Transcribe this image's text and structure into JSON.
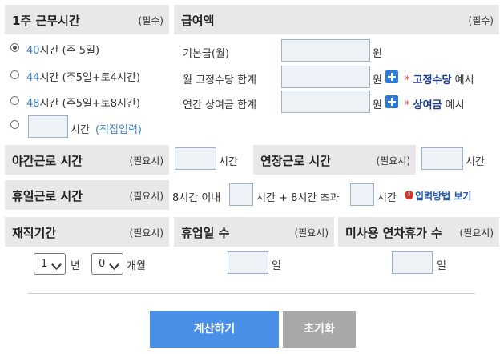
{
  "work_hours": {
    "title": "1주 근무시간",
    "required": "(필수)",
    "options": [
      {
        "hours": "40",
        "unit": "시간",
        "note": "(주 5일)",
        "selected": true
      },
      {
        "hours": "44",
        "unit": "시간",
        "note": "(주5일+토4시간)",
        "selected": false
      },
      {
        "hours": "48",
        "unit": "시간",
        "note": "(주5일+토8시간)",
        "selected": false
      }
    ],
    "custom": {
      "unit": "시간",
      "note": "(직접입력)",
      "value": ""
    }
  },
  "salary": {
    "title": "급여액",
    "required": "(필수)",
    "base": {
      "label": "기본급(월)",
      "unit": "원",
      "value": ""
    },
    "fixed_allowance": {
      "label": "월 고정수당 합계",
      "unit": "원",
      "star": "*",
      "link": "고정수당",
      "suffix": "예시",
      "value": ""
    },
    "bonus": {
      "label": "연간 상여금 합계",
      "unit": "원",
      "star": "*",
      "link": "상여금",
      "suffix": "예시",
      "value": ""
    }
  },
  "night": {
    "title": "야간근로 시간",
    "required": "(필요시)",
    "unit": "시간",
    "value": ""
  },
  "overtime": {
    "title": "연장근로 시간",
    "required": "(필요시)",
    "unit": "시간",
    "value": ""
  },
  "holiday": {
    "title": "휴일근로 시간",
    "required": "(필요시)",
    "within_label": "8시간 이내",
    "mid_label": "시간 + 8시간 초과",
    "unit": "시간",
    "help": "입력방법 보기",
    "info_glyph": "i"
  },
  "tenure": {
    "title": "재직기간",
    "required": "(필요시)",
    "years": "1",
    "years_unit": "년",
    "months": "0",
    "months_unit": "개월"
  },
  "leave_days": {
    "title": "휴업일 수",
    "required": "(필요시)",
    "unit": "일",
    "value": ""
  },
  "unused_leave": {
    "title": "미사용 연차휴가 수",
    "required": "(필요시)",
    "unit": "일",
    "value": ""
  },
  "buttons": {
    "calculate": "계산하기",
    "reset": "초기화"
  },
  "colors": {
    "header_bg": "#e8e8e8",
    "input_bg": "#eef2f7",
    "primary": "#4a8fe7",
    "secondary": "#a8a8a8",
    "link": "#3c82c8"
  }
}
